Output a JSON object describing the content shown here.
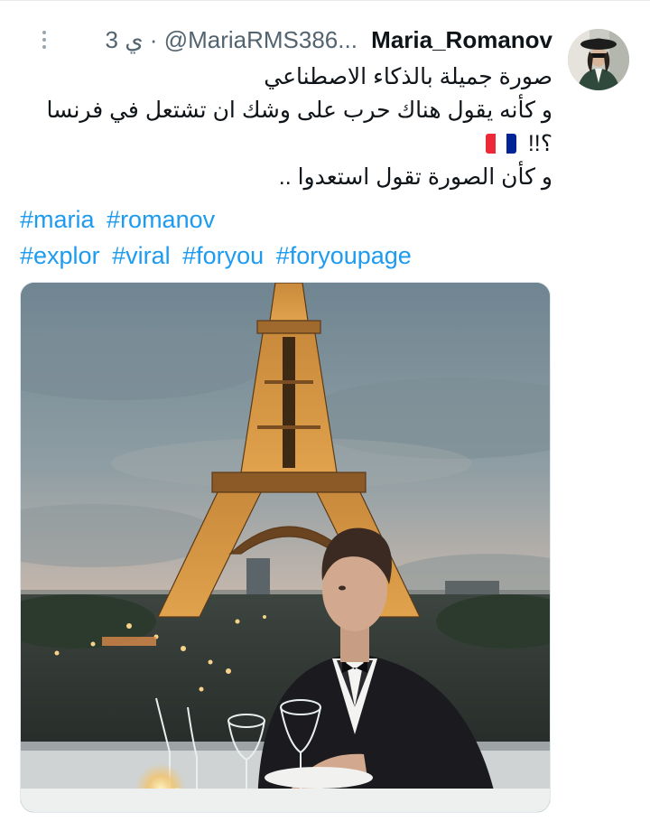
{
  "author": {
    "display_name": "Maria_Romanov",
    "handle": "@MariaRMS386...",
    "separator": "·",
    "time": "3 ي",
    "avatar_icon": "user-avatar"
  },
  "menu": {
    "more_icon": "vertical-ellipsis-icon"
  },
  "tweet": {
    "lines": [
      "صورة جميلة بالذكاء الاصطناعي",
      "و كأنه يقول هناك حرب على وشك ان تشتعل في فرنسا",
      "؟!!",
      "و كأن الصورة تقول استعدوا .."
    ],
    "flag": "French flag",
    "hashtags_line1": [
      "#maria",
      "#romanov"
    ],
    "hashtags_line2": [
      "#explor",
      "#viral",
      "#foryou",
      "#foryoupage"
    ]
  },
  "media": {
    "subject": "photo"
  },
  "colors": {
    "link": "#1d9bf0",
    "text": "#0f1419",
    "muted": "#536471"
  }
}
